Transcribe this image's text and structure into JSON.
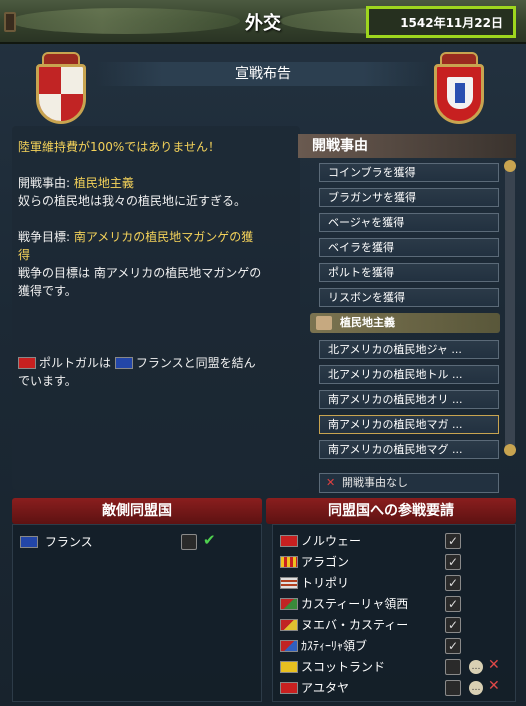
{
  "window": {
    "title": "外交",
    "date": "1542年11月22日",
    "subtitle": "宣戦布告"
  },
  "warning": "陸軍維持費が100%ではありません！",
  "casus_belli_label": "開戦事由:",
  "casus_belli_value": "植民地主義",
  "casus_belli_desc": "奴らの植民地は我々の植民地に近すぎる。",
  "war_goal_label": "戦争目標:",
  "war_goal_value_1": "南アメリカの植民地マガンゲの獲",
  "war_goal_value_2": "得",
  "war_goal_desc_1": "戦争の目標は 南アメリカの植民地マガンゲの",
  "war_goal_desc_2": "獲得です。",
  "alliance_note_1a": "ポルトガルは",
  "alliance_note_1b": "フランスと同盟を結ん",
  "alliance_note_2": "でいます。",
  "cb_panel": {
    "header": "開戦事由",
    "items": [
      "コインブラを獲得",
      "ブラガンサを獲得",
      "ベージャを獲得",
      "ベイラを獲得",
      "ポルトを獲得",
      "リスボンを獲得"
    ],
    "category": "植民地主義",
    "colonial_items": [
      "北アメリカの植民地ジャ ...",
      "北アメリカの植民地トル ...",
      "南アメリカの植民地オリ ...",
      "南アメリカの植民地マガ ...",
      "南アメリカの植民地マグ ..."
    ],
    "no_cb": "開戦事由なし"
  },
  "enemy_allies": {
    "header": "敵側同盟国",
    "rows": [
      {
        "name": "フランス"
      }
    ]
  },
  "call_allies": {
    "header": "同盟国への参戦要請",
    "rows": [
      {
        "name": "ノルウェー"
      },
      {
        "name": "アラゴン"
      },
      {
        "name": "トリポリ"
      },
      {
        "name": "カスティーリャ領西"
      },
      {
        "name": "ヌエバ・カスティー"
      },
      {
        "name": "ｶｽﾃｨｰﾘｬ領ブ"
      },
      {
        "name": "スコットランド"
      },
      {
        "name": "アユタヤ"
      }
    ]
  }
}
